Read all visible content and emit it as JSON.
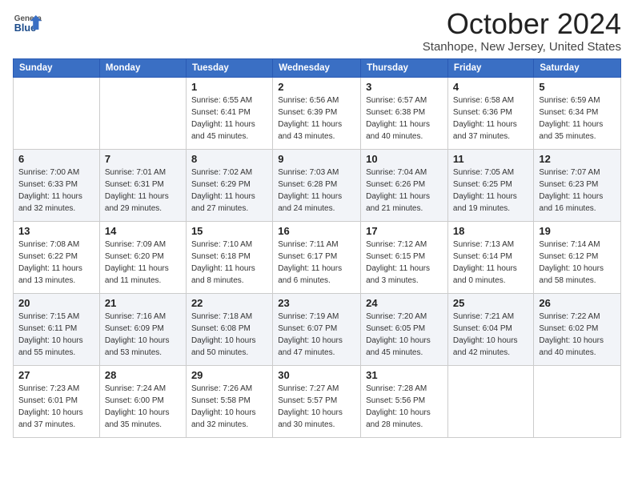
{
  "logo": {
    "general": "General",
    "blue": "Blue"
  },
  "title": "October 2024",
  "location": "Stanhope, New Jersey, United States",
  "weekdays": [
    "Sunday",
    "Monday",
    "Tuesday",
    "Wednesday",
    "Thursday",
    "Friday",
    "Saturday"
  ],
  "weeks": [
    [
      {
        "day": "",
        "info": ""
      },
      {
        "day": "",
        "info": ""
      },
      {
        "day": "1",
        "info": "Sunrise: 6:55 AM\nSunset: 6:41 PM\nDaylight: 11 hours and 45 minutes."
      },
      {
        "day": "2",
        "info": "Sunrise: 6:56 AM\nSunset: 6:39 PM\nDaylight: 11 hours and 43 minutes."
      },
      {
        "day": "3",
        "info": "Sunrise: 6:57 AM\nSunset: 6:38 PM\nDaylight: 11 hours and 40 minutes."
      },
      {
        "day": "4",
        "info": "Sunrise: 6:58 AM\nSunset: 6:36 PM\nDaylight: 11 hours and 37 minutes."
      },
      {
        "day": "5",
        "info": "Sunrise: 6:59 AM\nSunset: 6:34 PM\nDaylight: 11 hours and 35 minutes."
      }
    ],
    [
      {
        "day": "6",
        "info": "Sunrise: 7:00 AM\nSunset: 6:33 PM\nDaylight: 11 hours and 32 minutes."
      },
      {
        "day": "7",
        "info": "Sunrise: 7:01 AM\nSunset: 6:31 PM\nDaylight: 11 hours and 29 minutes."
      },
      {
        "day": "8",
        "info": "Sunrise: 7:02 AM\nSunset: 6:29 PM\nDaylight: 11 hours and 27 minutes."
      },
      {
        "day": "9",
        "info": "Sunrise: 7:03 AM\nSunset: 6:28 PM\nDaylight: 11 hours and 24 minutes."
      },
      {
        "day": "10",
        "info": "Sunrise: 7:04 AM\nSunset: 6:26 PM\nDaylight: 11 hours and 21 minutes."
      },
      {
        "day": "11",
        "info": "Sunrise: 7:05 AM\nSunset: 6:25 PM\nDaylight: 11 hours and 19 minutes."
      },
      {
        "day": "12",
        "info": "Sunrise: 7:07 AM\nSunset: 6:23 PM\nDaylight: 11 hours and 16 minutes."
      }
    ],
    [
      {
        "day": "13",
        "info": "Sunrise: 7:08 AM\nSunset: 6:22 PM\nDaylight: 11 hours and 13 minutes."
      },
      {
        "day": "14",
        "info": "Sunrise: 7:09 AM\nSunset: 6:20 PM\nDaylight: 11 hours and 11 minutes."
      },
      {
        "day": "15",
        "info": "Sunrise: 7:10 AM\nSunset: 6:18 PM\nDaylight: 11 hours and 8 minutes."
      },
      {
        "day": "16",
        "info": "Sunrise: 7:11 AM\nSunset: 6:17 PM\nDaylight: 11 hours and 6 minutes."
      },
      {
        "day": "17",
        "info": "Sunrise: 7:12 AM\nSunset: 6:15 PM\nDaylight: 11 hours and 3 minutes."
      },
      {
        "day": "18",
        "info": "Sunrise: 7:13 AM\nSunset: 6:14 PM\nDaylight: 11 hours and 0 minutes."
      },
      {
        "day": "19",
        "info": "Sunrise: 7:14 AM\nSunset: 6:12 PM\nDaylight: 10 hours and 58 minutes."
      }
    ],
    [
      {
        "day": "20",
        "info": "Sunrise: 7:15 AM\nSunset: 6:11 PM\nDaylight: 10 hours and 55 minutes."
      },
      {
        "day": "21",
        "info": "Sunrise: 7:16 AM\nSunset: 6:09 PM\nDaylight: 10 hours and 53 minutes."
      },
      {
        "day": "22",
        "info": "Sunrise: 7:18 AM\nSunset: 6:08 PM\nDaylight: 10 hours and 50 minutes."
      },
      {
        "day": "23",
        "info": "Sunrise: 7:19 AM\nSunset: 6:07 PM\nDaylight: 10 hours and 47 minutes."
      },
      {
        "day": "24",
        "info": "Sunrise: 7:20 AM\nSunset: 6:05 PM\nDaylight: 10 hours and 45 minutes."
      },
      {
        "day": "25",
        "info": "Sunrise: 7:21 AM\nSunset: 6:04 PM\nDaylight: 10 hours and 42 minutes."
      },
      {
        "day": "26",
        "info": "Sunrise: 7:22 AM\nSunset: 6:02 PM\nDaylight: 10 hours and 40 minutes."
      }
    ],
    [
      {
        "day": "27",
        "info": "Sunrise: 7:23 AM\nSunset: 6:01 PM\nDaylight: 10 hours and 37 minutes."
      },
      {
        "day": "28",
        "info": "Sunrise: 7:24 AM\nSunset: 6:00 PM\nDaylight: 10 hours and 35 minutes."
      },
      {
        "day": "29",
        "info": "Sunrise: 7:26 AM\nSunset: 5:58 PM\nDaylight: 10 hours and 32 minutes."
      },
      {
        "day": "30",
        "info": "Sunrise: 7:27 AM\nSunset: 5:57 PM\nDaylight: 10 hours and 30 minutes."
      },
      {
        "day": "31",
        "info": "Sunrise: 7:28 AM\nSunset: 5:56 PM\nDaylight: 10 hours and 28 minutes."
      },
      {
        "day": "",
        "info": ""
      },
      {
        "day": "",
        "info": ""
      }
    ]
  ]
}
